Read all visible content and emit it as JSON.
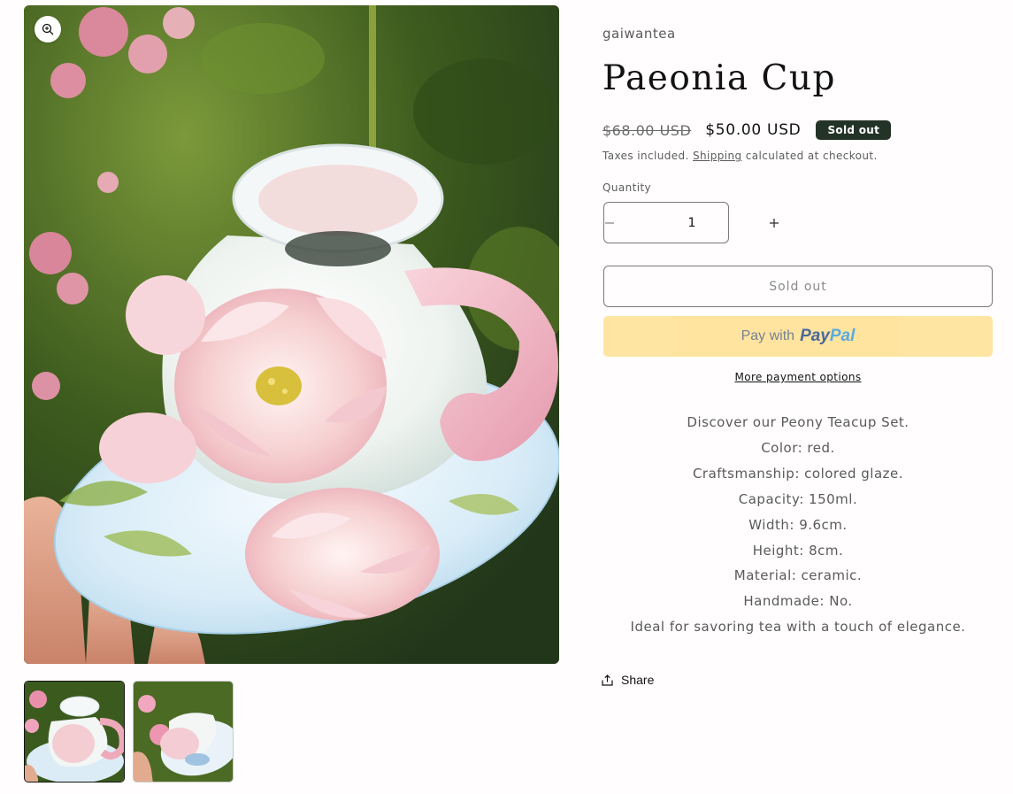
{
  "gallery": {
    "main_image": {
      "subject": "pink peony teacup on saucer held in hand, garden background"
    },
    "zoom_icon": "magnifier-plus-icon",
    "thumbnails": [
      {
        "subject": "teacup top view on saucer",
        "selected": true
      },
      {
        "subject": "teacup side view with saucer",
        "selected": false
      }
    ]
  },
  "product": {
    "vendor": "gaiwantea",
    "title": "Paeonia Cup",
    "price": {
      "compare_at": "$68.00 USD",
      "sale": "$50.00 USD",
      "badge": "Sold out"
    },
    "tax_note": {
      "prefix": "Taxes included.",
      "link": "Shipping",
      "suffix": "calculated at checkout."
    },
    "quantity": {
      "label": "Quantity",
      "value": "1",
      "decrease_icon": "minus-icon",
      "increase_icon": "plus-icon"
    },
    "buttons": {
      "sold_out": "Sold out",
      "paypal_prefix": "Pay with",
      "paypal_pay": "Pay",
      "paypal_pal": "Pal",
      "more_payment": "More payment options"
    },
    "description": [
      "Discover our Peony Teacup Set.",
      "Color: red.",
      "Craftsmanship: colored glaze.",
      "Capacity: 150ml.",
      "Width: 9.6cm.",
      "Height: 8cm.",
      "Material: ceramic.",
      "Handmade: No.",
      "Ideal for savoring tea with a touch of elegance."
    ],
    "share_label": "Share"
  },
  "colors": {
    "badge_bg": "#243327",
    "paypal_yellow": "#ffe090",
    "paypal_dark": "#2b4f8a",
    "paypal_light": "#3b9ddb"
  }
}
